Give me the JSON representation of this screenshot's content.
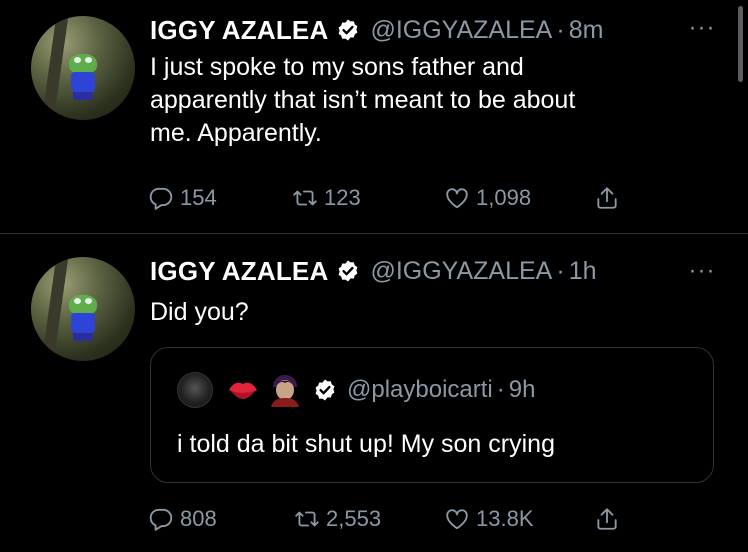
{
  "tweets": [
    {
      "display_name": "IGGY AZALEA",
      "handle": "@IGGYAZALEA",
      "separator": "·",
      "time": "8m",
      "more": "···",
      "text_lines": [
        "I just spoke to my sons father and",
        "apparently that isn’t meant to be about",
        "me. Apparently."
      ],
      "replies": "154",
      "retweets": "123",
      "likes": "1,098"
    },
    {
      "display_name": "IGGY AZALEA",
      "handle": "@IGGYAZALEA",
      "separator": "·",
      "time": "1h",
      "more": "···",
      "text_lines": [
        "Did you?"
      ],
      "quoted": {
        "handle": "@playboicarti",
        "separator": "·",
        "time": "9h",
        "text": "i told da bit shut up! My son crying"
      },
      "replies": "808",
      "retweets": "2,553",
      "likes": "13.8K"
    }
  ],
  "icons": {
    "verified": "verified-badge-icon",
    "reply": "reply-icon",
    "retweet": "retweet-icon",
    "like": "heart-icon",
    "share": "share-icon"
  },
  "colors": {
    "background": "#000000",
    "text": "#ffffff",
    "muted": "#8b98a5",
    "divider": "#2f3336"
  }
}
